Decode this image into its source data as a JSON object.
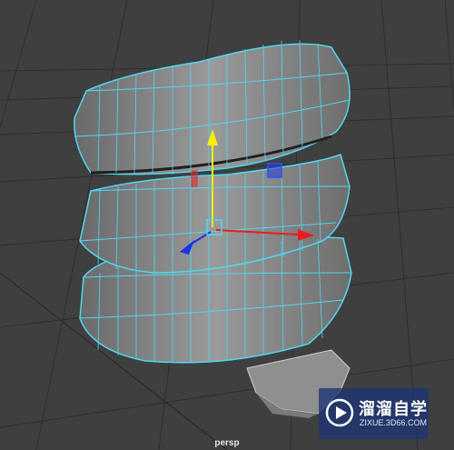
{
  "viewport": {
    "camera_label": "persp"
  },
  "colors": {
    "background": "#3f3f3f",
    "grid": "#2c2c2c",
    "mesh_fill": "#8c8c8c",
    "wireframe": "#4fd8f0",
    "axis_y": "#ffee00",
    "axis_x": "#e81e1e",
    "axis_z": "#1a33e6"
  },
  "icons": {
    "manipulator": "move-tool-manipulator-icon",
    "watermark_logo": "play-circle-icon"
  },
  "watermark": {
    "title": "溜溜自学",
    "url": "ZIXUE.3D66.COM"
  }
}
